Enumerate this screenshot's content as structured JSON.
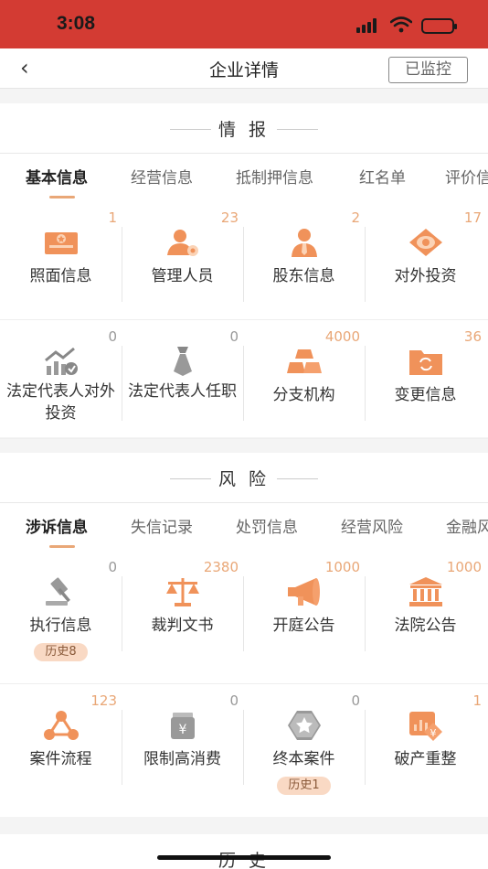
{
  "status_bar": {
    "time": "3:08"
  },
  "nav": {
    "back_icon": "chevron-left-icon",
    "title": "企业详情",
    "monitor_label": "已监控"
  },
  "intel": {
    "title": "情 报",
    "tabs": [
      "基本信息",
      "经营信息",
      "抵制押信息",
      "红名单",
      "评价信息"
    ],
    "rows": [
      [
        {
          "label": "照面信息",
          "count": "1",
          "icon": "certificate-icon"
        },
        {
          "label": "管理人员",
          "count": "23",
          "icon": "manager-icon"
        },
        {
          "label": "股东信息",
          "count": "2",
          "icon": "shareholder-icon"
        },
        {
          "label": "对外投资",
          "count": "17",
          "icon": "investment-icon"
        }
      ],
      [
        {
          "label": "法定代表人对外投资",
          "count": "0",
          "icon": "rep-investment-icon"
        },
        {
          "label": "法定代表人任职",
          "count": "0",
          "icon": "tie-icon"
        },
        {
          "label": "分支机构",
          "count": "4000",
          "icon": "gold-bars-icon"
        },
        {
          "label": "变更信息",
          "count": "36",
          "icon": "folder-change-icon"
        }
      ]
    ]
  },
  "risk": {
    "title": "风 险",
    "tabs": [
      "涉诉信息",
      "失信记录",
      "处罚信息",
      "经营风险",
      "金融风险"
    ],
    "rows": [
      [
        {
          "label": "执行信息",
          "count": "0",
          "icon": "gavel-icon",
          "badge": "历史8"
        },
        {
          "label": "裁判文书",
          "count": "2380",
          "icon": "scales-icon"
        },
        {
          "label": "开庭公告",
          "count": "1000",
          "icon": "megaphone-icon"
        },
        {
          "label": "法院公告",
          "count": "1000",
          "icon": "courthouse-icon"
        }
      ],
      [
        {
          "label": "案件流程",
          "count": "123",
          "icon": "process-icon"
        },
        {
          "label": "限制高消费",
          "count": "0",
          "icon": "wallet-icon"
        },
        {
          "label": "终本案件",
          "count": "0",
          "icon": "star-badge-icon",
          "badge": "历史1"
        },
        {
          "label": "破产重整",
          "count": "1",
          "icon": "bankruptcy-icon"
        }
      ]
    ]
  },
  "history": {
    "title": "历 史"
  },
  "colors": {
    "brand_red": "#d33b33",
    "accent_orange": "#e9a777",
    "icon_orange": "#f0925a"
  }
}
